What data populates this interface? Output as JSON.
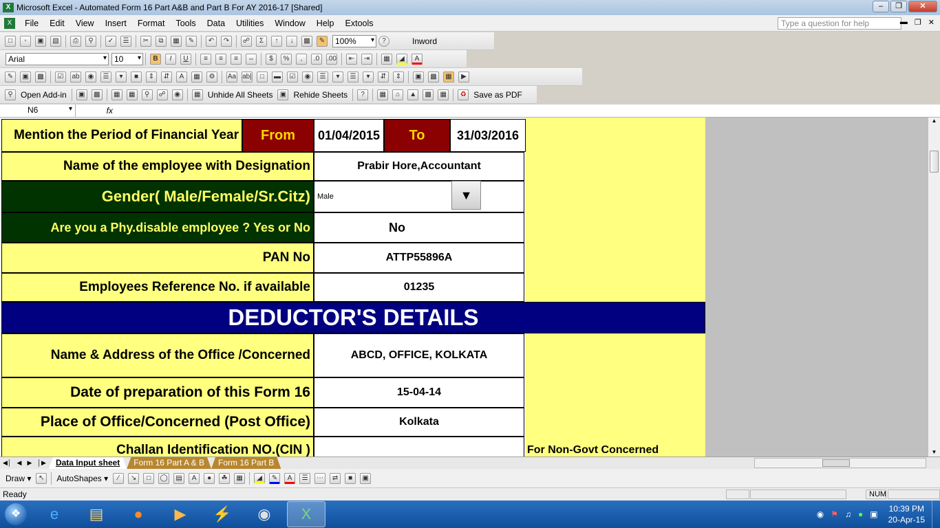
{
  "window": {
    "title": "Microsoft Excel - Automated Form 16 Part A&B and Part B For AY 2016-17  [Shared]",
    "minimize": "–",
    "restore": "❐",
    "close": "✕"
  },
  "menu": {
    "items": [
      "File",
      "Edit",
      "View",
      "Insert",
      "Format",
      "Tools",
      "Data",
      "Utilities",
      "Window",
      "Help",
      "Extools"
    ],
    "help_placeholder": "Type a question for help"
  },
  "toolbar1": {
    "zoom": "100%",
    "inword": "Inword"
  },
  "toolbar2": {
    "font": "Arial",
    "size": "10"
  },
  "toolbar4": {
    "open_addin": "Open Add-in",
    "unhide": "Unhide All Sheets",
    "rehide": "Rehide Sheets",
    "save_pdf": "Save as PDF"
  },
  "formula": {
    "cell_ref": "N6",
    "fx": "fx",
    "content": ""
  },
  "form": {
    "period_label": "Mention the Period of Financial Year",
    "from_label": "From",
    "from_value": "01/04/2015",
    "to_label": "To",
    "to_value": "31/03/2016",
    "employee_label": "Name of the employee with Designation",
    "employee_value": "Prabir Hore,Accountant",
    "gender_label": "Gender( Male/Female/Sr.Citz)",
    "gender_value": "Male",
    "disable_label": "Are you a Phy.disable employee ? Yes or No",
    "disable_value": "No",
    "pan_label": "PAN No",
    "pan_value": "ATTP55896A",
    "ref_label": "Employees Reference No. if available",
    "ref_value": "01235",
    "deductor_header": "DEDUCTOR'S DETAILS",
    "office_label": "Name  & Address of the Office /Concerned",
    "office_value": "ABCD, OFFICE, KOLKATA",
    "date_label": "Date of preparation of this Form 16",
    "date_value": "15-04-14",
    "place_label": "Place of Office/Concerned (Post Office)",
    "place_value": "Kolkata",
    "challan_label": "Challan Identification NO.(CIN )",
    "challan_note": "For Non-Govt Concerned"
  },
  "tabs": [
    {
      "label": "Data Input sheet",
      "active": true
    },
    {
      "label": "Form 16 Part A & B",
      "active": false
    },
    {
      "label": "Form 16 Part B",
      "active": false
    }
  ],
  "drawbar": {
    "draw": "Draw ▾",
    "autoshapes": "AutoShapes ▾"
  },
  "status": {
    "ready": "Ready",
    "num": "NUM"
  },
  "taskbar": {
    "time": "10:39 PM",
    "date": "20-Apr-15"
  },
  "colors": {
    "label_bg": "#ffff80",
    "dark_red": "#8b0000",
    "from_text": "#ffd700",
    "dark_green": "#003300",
    "green_text": "#ffff66",
    "navy": "#000080"
  }
}
